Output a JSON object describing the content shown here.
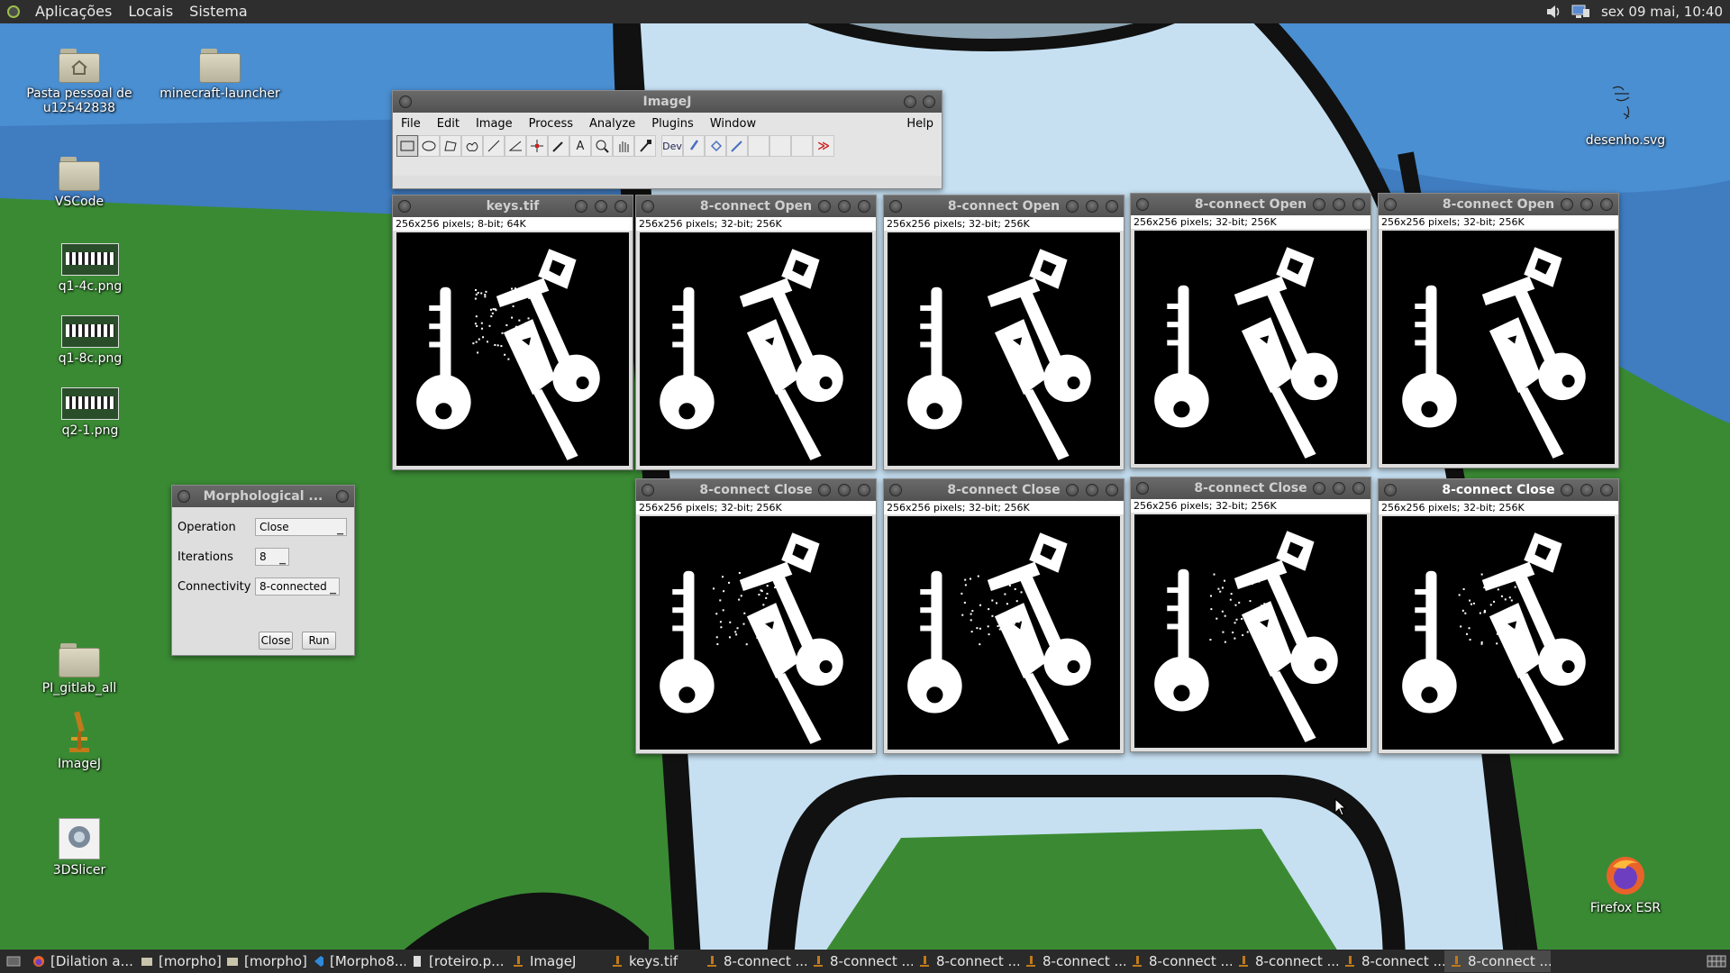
{
  "top_panel": {
    "menus": [
      "Aplicações",
      "Locais",
      "Sistema"
    ],
    "clock": "sex 09 mai, 10:40",
    "tray_icons": [
      "volume-icon",
      "network-icon"
    ]
  },
  "desktop_icons_left": [
    {
      "label": "Pasta pessoal de u12542838",
      "icon": "home-folder-icon"
    },
    {
      "label": "minecraft-launcher",
      "icon": "folder-icon"
    },
    {
      "label": "VSCode",
      "icon": "folder-icon"
    },
    {
      "label": "q1-4c.png",
      "icon": "image-thumbnail-icon"
    },
    {
      "label": "q1-8c.png",
      "icon": "image-thumbnail-icon"
    },
    {
      "label": "q2-1.png",
      "icon": "image-thumbnail-icon"
    },
    {
      "label": "PI_gitlab_all",
      "icon": "folder-icon"
    },
    {
      "label": "ImageJ",
      "icon": "imagej-microscope-icon"
    },
    {
      "label": "3DSlicer",
      "icon": "3dslicer-icon"
    }
  ],
  "desktop_icons_right": [
    {
      "label": "desenho.svg",
      "icon": "svg-file-icon"
    },
    {
      "label": "Firefox ESR",
      "icon": "firefox-icon"
    }
  ],
  "imagej": {
    "title": "ImageJ",
    "menu": [
      "File",
      "Edit",
      "Image",
      "Process",
      "Analyze",
      "Plugins",
      "Window",
      "Help"
    ],
    "tools": [
      "rectangle-tool-icon",
      "oval-tool-icon",
      "polygon-tool-icon",
      "freehand-tool-icon",
      "line-tool-icon",
      "angle-tool-icon",
      "point-tool-icon",
      "wand-tool-icon",
      "text-tool-icon",
      "zoom-tool-icon",
      "hand-tool-icon",
      "color-picker-tool-icon",
      "dev-tool-icon",
      "brush-tool-icon",
      "flood-fill-tool-icon",
      "pencil-tool-icon",
      "blank-tool-icon",
      "blank-tool-icon",
      "blank-tool-icon",
      "more-tools-icon"
    ],
    "dev_label": "Dev",
    "more_label": "≫",
    "text_tool": "A"
  },
  "image_windows": [
    {
      "title": "keys.tif",
      "info": "256x256 pixels; 8-bit; 64K"
    },
    {
      "title": "8-connect Open",
      "info": "256x256 pixels; 32-bit; 256K"
    },
    {
      "title": "8-connect Open",
      "info": "256x256 pixels; 32-bit; 256K"
    },
    {
      "title": "8-connect Open",
      "info": "256x256 pixels; 32-bit; 256K"
    },
    {
      "title": "8-connect Open",
      "info": "256x256 pixels; 32-bit; 256K"
    },
    {
      "title": "8-connect Close",
      "info": "256x256 pixels; 32-bit; 256K"
    },
    {
      "title": "8-connect Close",
      "info": "256x256 pixels; 32-bit; 256K"
    },
    {
      "title": "8-connect Close",
      "info": "256x256 pixels; 32-bit; 256K"
    },
    {
      "title": "8-connect Close",
      "info": "256x256 pixels; 32-bit; 256K"
    }
  ],
  "morph_dialog": {
    "title": "Morphological ...",
    "operation_label": "Operation",
    "operation_value": "Close",
    "iterations_label": "Iterations",
    "iterations_value": "8",
    "connectivity_label": "Connectivity",
    "connectivity_value": "8-connected",
    "close_button": "Close",
    "run_button": "Run"
  },
  "taskbar": {
    "items": [
      {
        "label": "[Dilation a...",
        "icon": "firefox-icon"
      },
      {
        "label": "[morpho]",
        "icon": "folder-icon"
      },
      {
        "label": "[morpho]",
        "icon": "folder-icon"
      },
      {
        "label": "[Morpho8....",
        "icon": "vscode-icon"
      },
      {
        "label": "[roteiro.p...",
        "icon": "document-icon"
      },
      {
        "label": "ImageJ",
        "icon": "imagej-icon"
      },
      {
        "label": "keys.tif",
        "icon": "imagej-icon"
      },
      {
        "label": "8-connect ...",
        "icon": "imagej-icon"
      },
      {
        "label": "8-connect ...",
        "icon": "imagej-icon"
      },
      {
        "label": "8-connect ...",
        "icon": "imagej-icon"
      },
      {
        "label": "8-connect ...",
        "icon": "imagej-icon"
      },
      {
        "label": "8-connect ...",
        "icon": "imagej-icon"
      },
      {
        "label": "8-connect ...",
        "icon": "imagej-icon"
      },
      {
        "label": "8-connect ...",
        "icon": "imagej-icon"
      },
      {
        "label": "8-connect ...",
        "icon": "imagej-icon"
      }
    ],
    "active_index": 14
  },
  "colors": {
    "panel_bg": "#2e2e2e",
    "titlebar": "#5c5c5c",
    "wall_green": "#3a8a32",
    "wall_sky": "#c8e2f2"
  }
}
